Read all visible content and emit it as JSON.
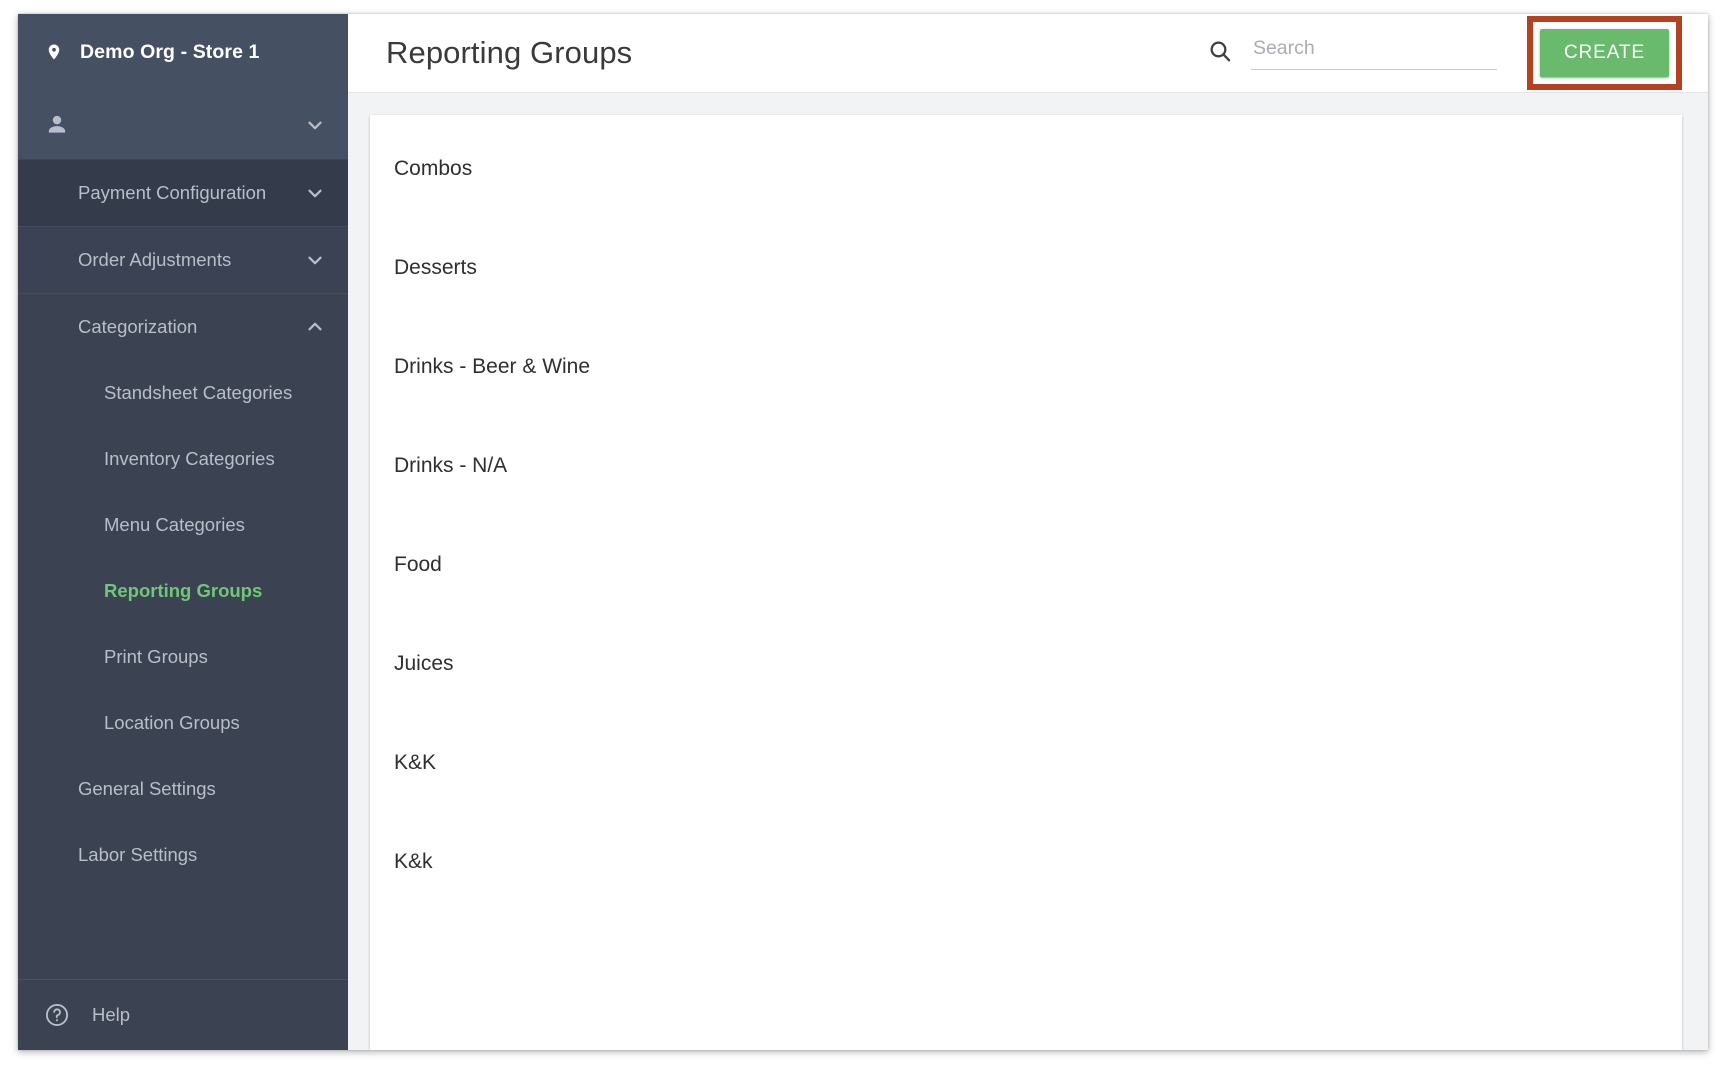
{
  "sidebar": {
    "org_name": "Demo Org - Store 1",
    "location_icon": "location-pin-icon",
    "user_icon": "person-icon",
    "user_chevron": "chevron-down-icon",
    "sections": [
      {
        "label": "Payment Configuration",
        "chevron": "chevron-down-icon",
        "expanded": false
      },
      {
        "label": "Order Adjustments",
        "chevron": "chevron-down-icon",
        "expanded": false
      },
      {
        "label": "Categorization",
        "chevron": "chevron-up-icon",
        "expanded": true
      }
    ],
    "categorization_items": [
      {
        "label": "Standsheet Categories",
        "active": false
      },
      {
        "label": "Inventory Categories",
        "active": false
      },
      {
        "label": "Menu Categories",
        "active": false
      },
      {
        "label": "Reporting Groups",
        "active": true
      },
      {
        "label": "Print Groups",
        "active": false
      },
      {
        "label": "Location Groups",
        "active": false
      }
    ],
    "bottom_items": [
      {
        "label": "General Settings"
      },
      {
        "label": "Labor Settings"
      }
    ],
    "help": {
      "label": "Help",
      "icon": "help-circle-icon"
    },
    "active_color": "#72c776",
    "background_color": "#3b4252",
    "header_color": "#465063"
  },
  "topbar": {
    "title": "Reporting Groups",
    "search": {
      "icon": "search-icon",
      "placeholder": "Search",
      "value": ""
    },
    "create_label": "CREATE",
    "create_color": "#6aba6e",
    "annotation_color": "#b4411f"
  },
  "main": {
    "groups": [
      {
        "name": "Combos"
      },
      {
        "name": "Desserts"
      },
      {
        "name": "Drinks - Beer & Wine"
      },
      {
        "name": "Drinks - N/A"
      },
      {
        "name": "Food"
      },
      {
        "name": "Juices"
      },
      {
        "name": "K&K"
      },
      {
        "name": "K&k"
      }
    ]
  }
}
